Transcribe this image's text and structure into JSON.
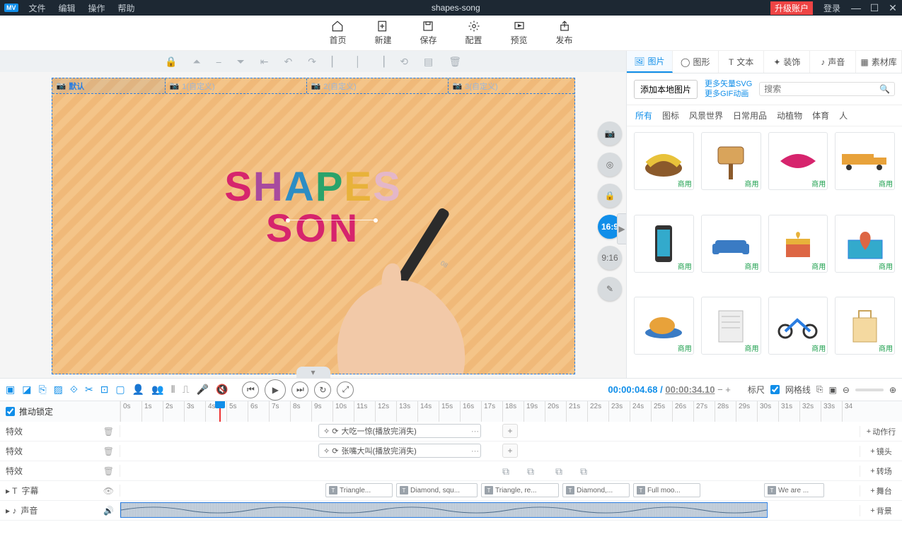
{
  "titlebar": {
    "logo": "MV",
    "menus": [
      "文件",
      "编辑",
      "操作",
      "帮助"
    ],
    "title": "shapes-song",
    "upgrade": "升级账户",
    "login": "登录"
  },
  "maintool": [
    {
      "k": "home",
      "l": "首页"
    },
    {
      "k": "new",
      "l": "新建"
    },
    {
      "k": "save",
      "l": "保存"
    },
    {
      "k": "config",
      "l": "配置"
    },
    {
      "k": "preview",
      "l": "预览"
    },
    {
      "k": "publish",
      "l": "发布"
    }
  ],
  "scenes": [
    {
      "l": "默认",
      "active": true
    },
    {
      "l": "1(自定义)"
    },
    {
      "l": "2(自定义)"
    },
    {
      "l": "3(自定义)"
    }
  ],
  "canvas_text": {
    "line1": "SHAPES",
    "line2": "SON"
  },
  "aspect": {
    "a": "16:9",
    "b": "9:16"
  },
  "panel": {
    "tabs": [
      "图片",
      "图形",
      "文本",
      "装饰",
      "声音",
      "素材库"
    ],
    "addlocal": "添加本地图片",
    "link1": "更多矢量SVG",
    "link2": "更多GIF动画",
    "search_ph": "搜索",
    "cats": [
      "所有",
      "图标",
      "风景世界",
      "日常用品",
      "动植物",
      "体育",
      "人"
    ],
    "tag": "商用"
  },
  "tlbar": {
    "time_cur": "00:00:04.68",
    "time_tot": "00:00:34.10",
    "ruler_label": "标尺",
    "grid_label": "网格线"
  },
  "lock": "推动锁定",
  "tracks": {
    "fx": "特效",
    "sub": "字幕",
    "snd": "声音",
    "clip1": "大吃一惊(播放完消失)",
    "clip2": "张嘴大叫(播放完消失)",
    "subs": [
      "Triangle...",
      "Diamond, squ...",
      "Triangle, re...",
      "Diamond,...",
      "Full moo...",
      "We are ..."
    ],
    "rb": [
      "动作行",
      "镜头",
      "转场",
      "舞台",
      "背景"
    ]
  },
  "ticks": [
    "0s",
    "1s",
    "2s",
    "3s",
    "4s",
    "5s",
    "6s",
    "7s",
    "8s",
    "9s",
    "10s",
    "11s",
    "12s",
    "13s",
    "14s",
    "15s",
    "16s",
    "17s",
    "18s",
    "19s",
    "20s",
    "21s",
    "22s",
    "23s",
    "24s",
    "25s",
    "26s",
    "27s",
    "28s",
    "29s",
    "30s",
    "31s",
    "32s",
    "33s",
    "34"
  ]
}
